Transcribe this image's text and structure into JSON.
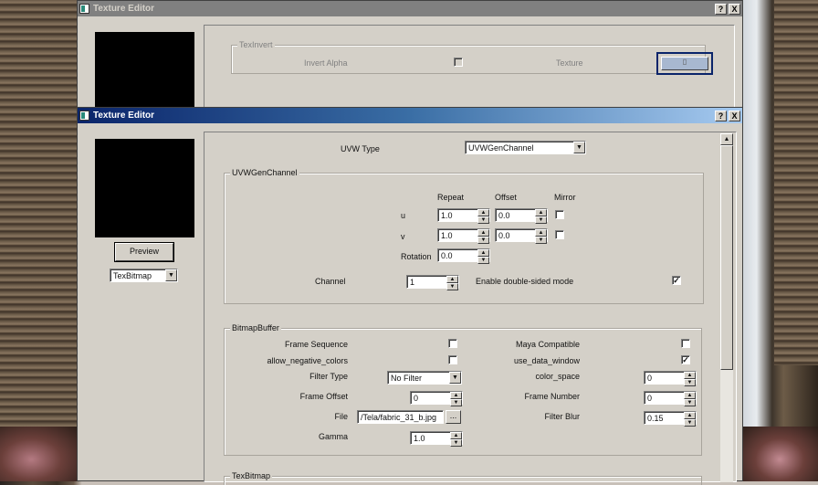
{
  "back_window": {
    "title": "Texture Editor",
    "help_label": "?",
    "close_label": "X",
    "group_title": "TexInvert",
    "invert_alpha_label": "Invert Alpha",
    "texture_label": "Texture"
  },
  "front_window": {
    "title": "Texture Editor",
    "help_label": "?",
    "close_label": "X",
    "preview_button": "Preview",
    "texture_type": "TexBitmap",
    "uvw_type_label": "UVW Type",
    "uvw_type_value": "UVWGenChannel",
    "uvwgen": {
      "group_title": "UVWGenChannel",
      "col_repeat": "Repeat",
      "col_offset": "Offset",
      "col_mirror": "Mirror",
      "u_label": "u",
      "u_repeat": "1.0",
      "u_offset": "0.0",
      "v_label": "v",
      "v_repeat": "1.0",
      "v_offset": "0.0",
      "rotation_label": "Rotation",
      "rotation_value": "0.0",
      "channel_label": "Channel",
      "channel_value": "1",
      "double_sided_label": "Enable double-sided mode",
      "double_sided_mark": "✓"
    },
    "bitmap": {
      "group_title": "BitmapBuffer",
      "frame_sequence_label": "Frame Sequence",
      "maya_compatible_label": "Maya Compatible",
      "allow_negative_label": "allow_negative_colors",
      "use_data_window_label": "use_data_window",
      "use_data_window_mark": "✓",
      "filter_type_label": "Filter Type",
      "filter_type_value": "No Filter",
      "color_space_label": "color_space",
      "color_space_value": "0",
      "frame_offset_label": "Frame Offset",
      "frame_offset_value": "0",
      "frame_number_label": "Frame Number",
      "frame_number_value": "0",
      "file_label": "File",
      "file_value": "/Tela/fabric_31_b.jpg",
      "browse_label": "...",
      "filter_blur_label": "Filter Blur",
      "filter_blur_value": "0.15",
      "gamma_label": "Gamma",
      "gamma_value": "1.0"
    },
    "texbitmap_group_title": "TexBitmap"
  }
}
